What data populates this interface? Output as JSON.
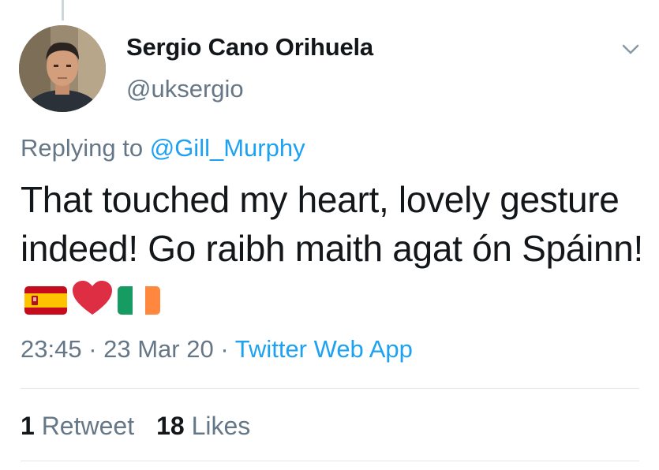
{
  "tweet": {
    "display_name": "Sergio Cano Orihuela",
    "handle": "@uksergio",
    "replying_prefix": "Replying to ",
    "replying_to": "@Gill_Murphy",
    "text": "That touched my heart, lovely gesture indeed! Go raibh maith agat ón Spáinn!",
    "emojis": [
      "spain-flag-icon",
      "red-heart-icon",
      "ireland-flag-icon"
    ],
    "time": "23:45",
    "separator": " · ",
    "date": "23 Mar 20",
    "source": "Twitter Web App"
  },
  "stats": {
    "retweet_count": "1",
    "retweet_label": "Retweet",
    "like_count": "18",
    "like_label": "Likes"
  },
  "colors": {
    "accent": "#1da1f2",
    "secondary_text": "#657786",
    "primary_text": "#14171a",
    "divider": "#e1e8ed"
  }
}
